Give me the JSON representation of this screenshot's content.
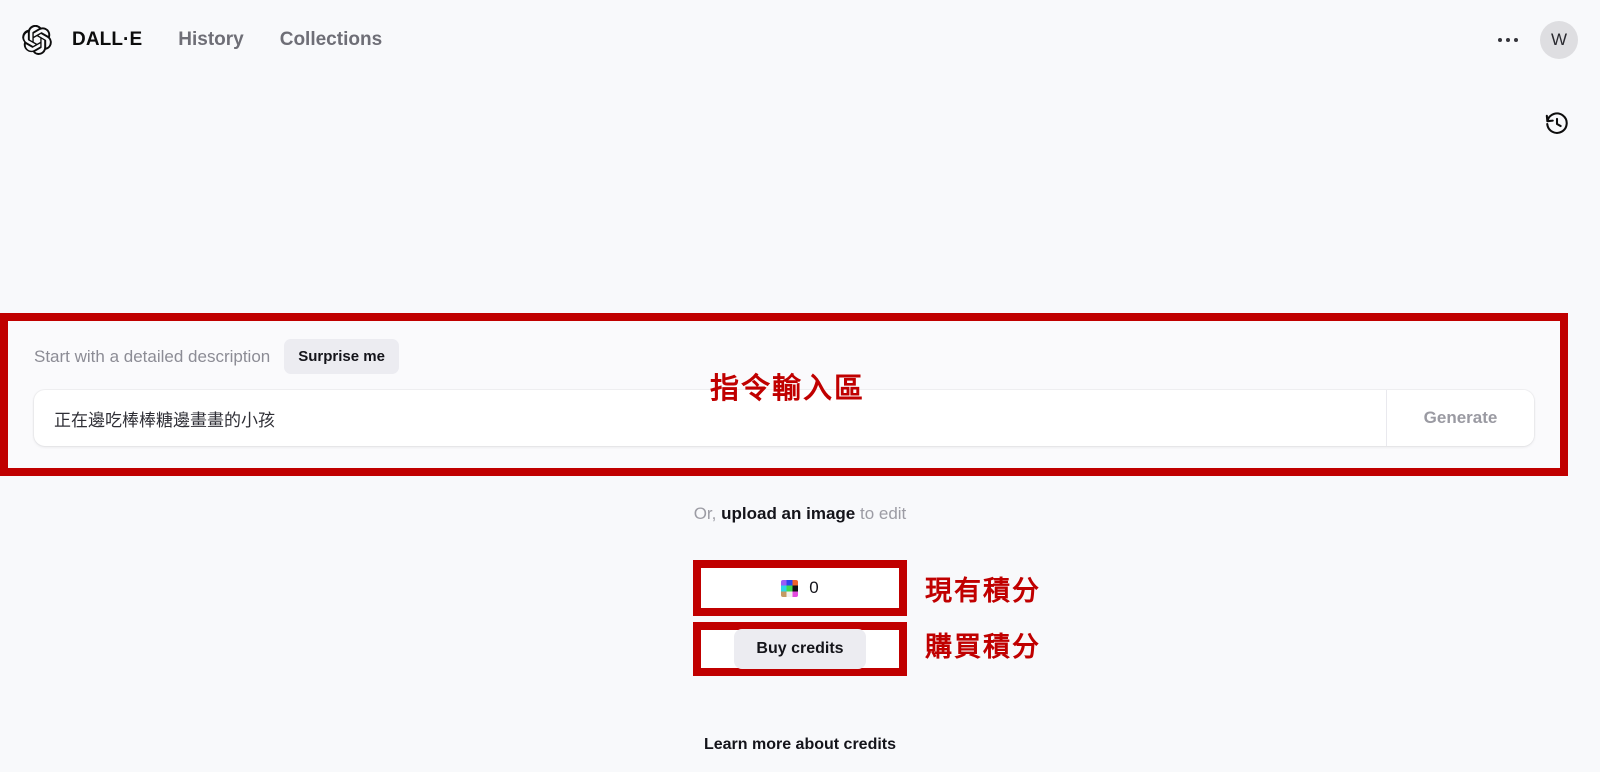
{
  "app": {
    "brand": "DALL·E",
    "logo_icon": "openai-logo-icon",
    "background_color": "#F8F9FB",
    "annotation_color": "#C00000"
  },
  "topbar": {
    "nav_items": [
      {
        "label": "History",
        "name": "nav-history"
      },
      {
        "label": "Collections",
        "name": "nav-collections"
      }
    ],
    "overflow_icon": "ellipsis-icon",
    "avatar_initial": "W"
  },
  "canvas": {
    "history_icon": "history-clock-icon"
  },
  "composer": {
    "hint": "Start with a detailed description",
    "surprise_label": "Surprise me",
    "prompt_value": "正在邊吃棒棒糖邊畫畫的小孩",
    "prompt_placeholder": "Start with a detailed description",
    "generate_label": "Generate",
    "annotation": "指令輸入區"
  },
  "upload": {
    "prefix": "Or, ",
    "link": "upload an image",
    "suffix": " to edit"
  },
  "credits": {
    "icon": "credits-color-grid-icon",
    "count": "0",
    "count_annotation": "現有積分",
    "buy_label": "Buy credits",
    "buy_annotation": "購買積分",
    "learn_more": "Learn more about credits",
    "icon_colors": [
      "#9B5CF6",
      "#2B43F0",
      "#F0612B",
      "#2BD6E8",
      "#3FD94A",
      "#111114",
      "#C39A63",
      "#F3F1EE",
      "#E44BE0"
    ]
  }
}
